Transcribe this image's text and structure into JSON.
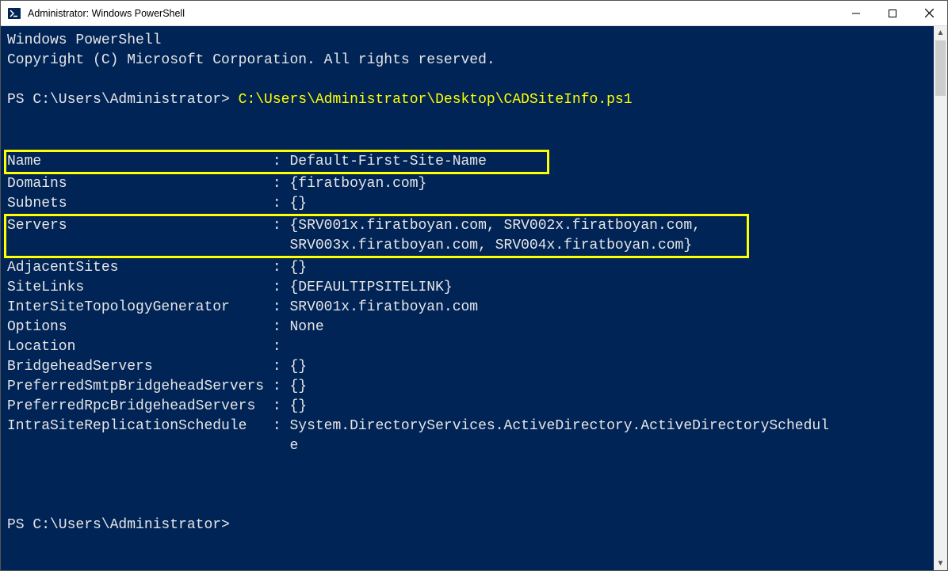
{
  "window": {
    "title": "Administrator: Windows PowerShell"
  },
  "terminal": {
    "header1": "Windows PowerShell",
    "header2": "Copyright (C) Microsoft Corporation. All rights reserved.",
    "prompt_prefix": "PS C:\\Users\\Administrator> ",
    "command": "C:\\Users\\Administrator\\Desktop\\CADSiteInfo.ps1",
    "rows": {
      "name": {
        "label": "Name                           : ",
        "value": "Default-First-Site-Name"
      },
      "domains": {
        "label": "Domains                        : ",
        "value": "{firatboyan.com}"
      },
      "subnets": {
        "label": "Subnets                        : ",
        "value": "{}"
      },
      "servers1": {
        "label": "Servers                        : ",
        "value": "{SRV001x.firatboyan.com, SRV002x.firatboyan.com,"
      },
      "servers2": {
        "label": "                                 ",
        "value": "SRV003x.firatboyan.com, SRV004x.firatboyan.com}"
      },
      "adjacent": {
        "label": "AdjacentSites                  : ",
        "value": "{}"
      },
      "sitelinks": {
        "label": "SiteLinks                      : ",
        "value": "{DEFAULTIPSITELINK}"
      },
      "istg": {
        "label": "InterSiteTopologyGenerator     : ",
        "value": "SRV001x.firatboyan.com"
      },
      "options": {
        "label": "Options                        : ",
        "value": "None"
      },
      "location": {
        "label": "Location                       : ",
        "value": ""
      },
      "bridgehead": {
        "label": "BridgeheadServers              : ",
        "value": "{}"
      },
      "prefsmtp": {
        "label": "PreferredSmtpBridgeheadServers : ",
        "value": "{}"
      },
      "prefrpc": {
        "label": "PreferredRpcBridgeheadServers  : ",
        "value": "{}"
      },
      "sched1": {
        "label": "IntraSiteReplicationSchedule   : ",
        "value": "System.DirectoryServices.ActiveDirectory.ActiveDirectorySchedul"
      },
      "sched2": {
        "label": "                                 ",
        "value": "e"
      }
    },
    "prompt2": "PS C:\\Users\\Administrator>"
  }
}
